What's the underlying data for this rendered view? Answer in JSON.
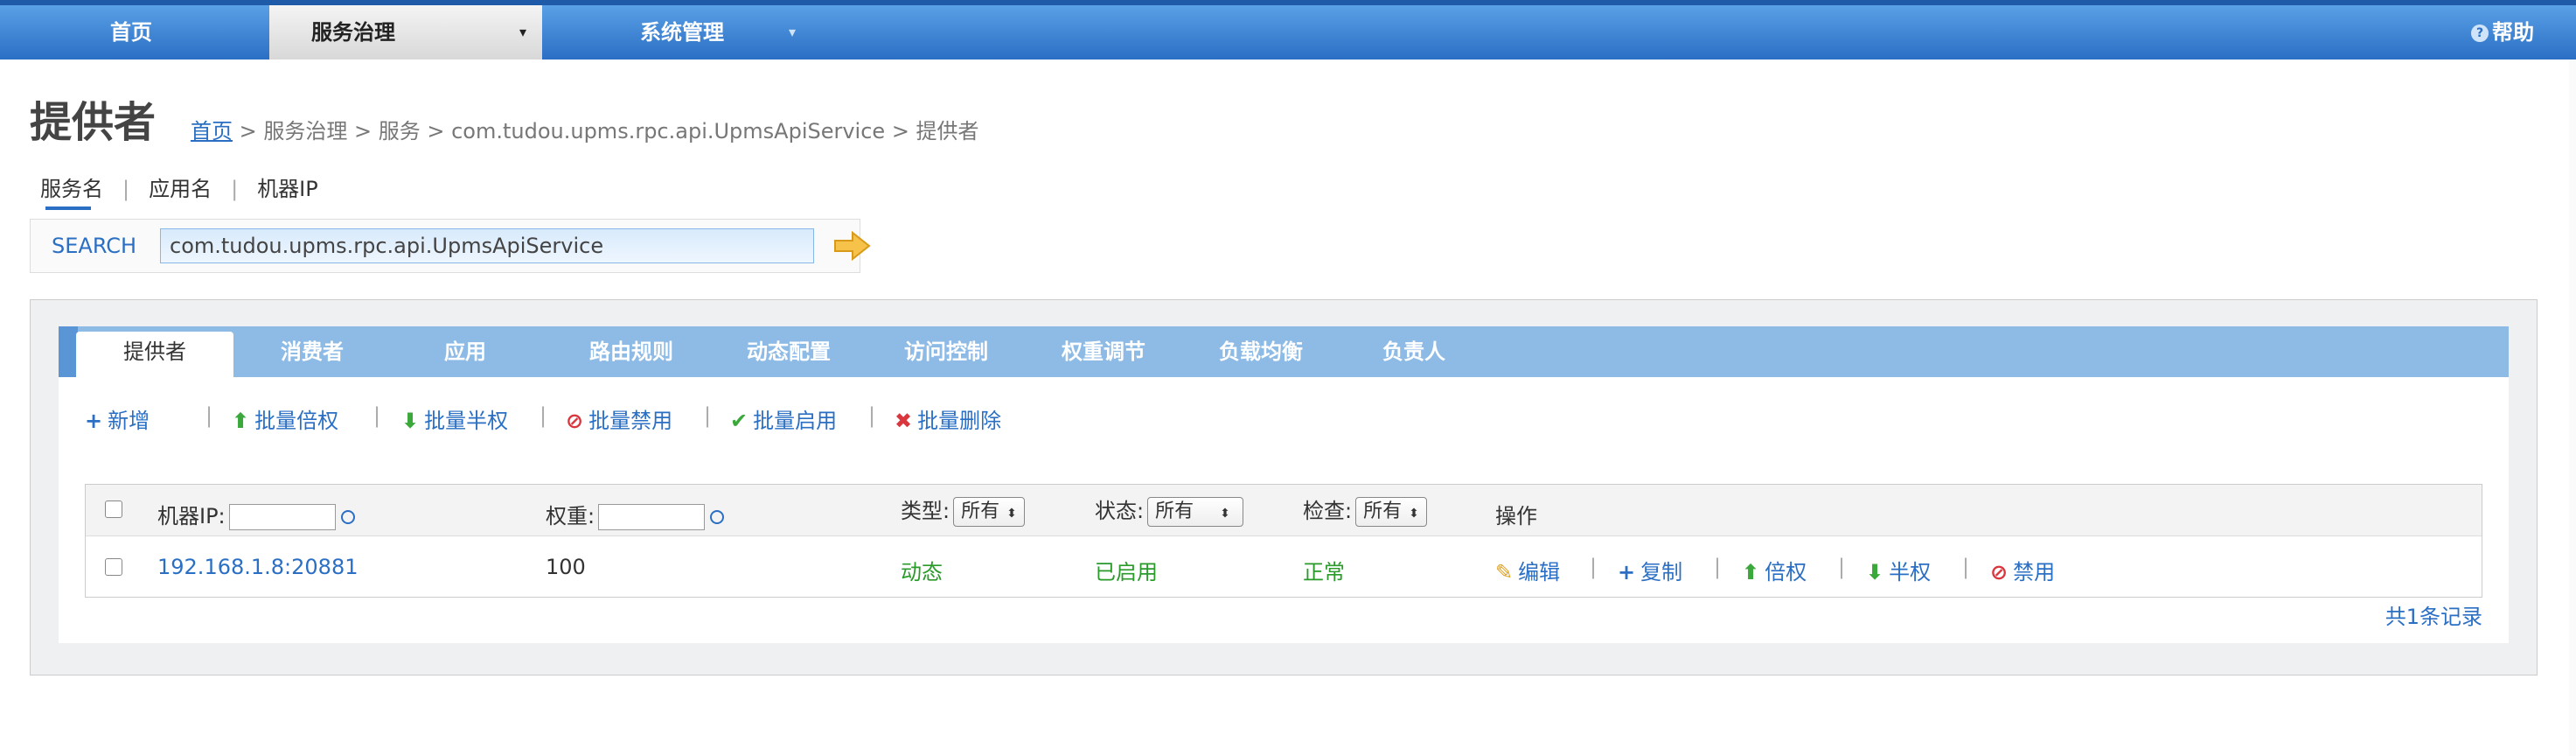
{
  "nav": {
    "items": [
      {
        "label": "首页"
      },
      {
        "label": "服务治理",
        "active": true,
        "caret": "▾"
      },
      {
        "label": "系统管理",
        "caret": "▾"
      }
    ],
    "help": "帮助",
    "help_icon": "?"
  },
  "page": {
    "title": "提供者",
    "breadcrumb": {
      "home": "首页",
      "rest": " > 服务治理 > 服务 > com.tudou.upms.rpc.api.UpmsApiService > 提供者"
    }
  },
  "search": {
    "tabs": [
      "服务名",
      "应用名",
      "机器IP"
    ],
    "separator": "|",
    "label": "SEARCH",
    "value": "com.tudou.upms.rpc.api.UpmsApiService"
  },
  "tabs": [
    "提供者",
    "消费者",
    "应用",
    "路由规则",
    "动态配置",
    "访问控制",
    "权重调节",
    "负载均衡",
    "负责人"
  ],
  "toolbar": {
    "add": "新增",
    "batch_double": "批量倍权",
    "batch_half": "批量半权",
    "batch_disable": "批量禁用",
    "batch_enable": "批量启用",
    "batch_delete": "批量删除",
    "separator": "|"
  },
  "table": {
    "headers": {
      "ip": "机器IP:",
      "weight": "权重:",
      "type": "类型:",
      "status": "状态:",
      "check": "检查:",
      "ops": "操作"
    },
    "filter_all": "所有",
    "rows": [
      {
        "ip": "192.168.1.8:20881",
        "weight": "100",
        "type": "动态",
        "status": "已启用",
        "check": "正常",
        "ops": {
          "edit": "编辑",
          "copy": "复制",
          "double": "倍权",
          "half": "半权",
          "disable": "禁用"
        }
      }
    ]
  },
  "total": "共1条记录",
  "colors": {
    "accent": "#2a6fc4",
    "tab_bar": "#8dbbe6",
    "ok_green": "#2a9a2a"
  }
}
